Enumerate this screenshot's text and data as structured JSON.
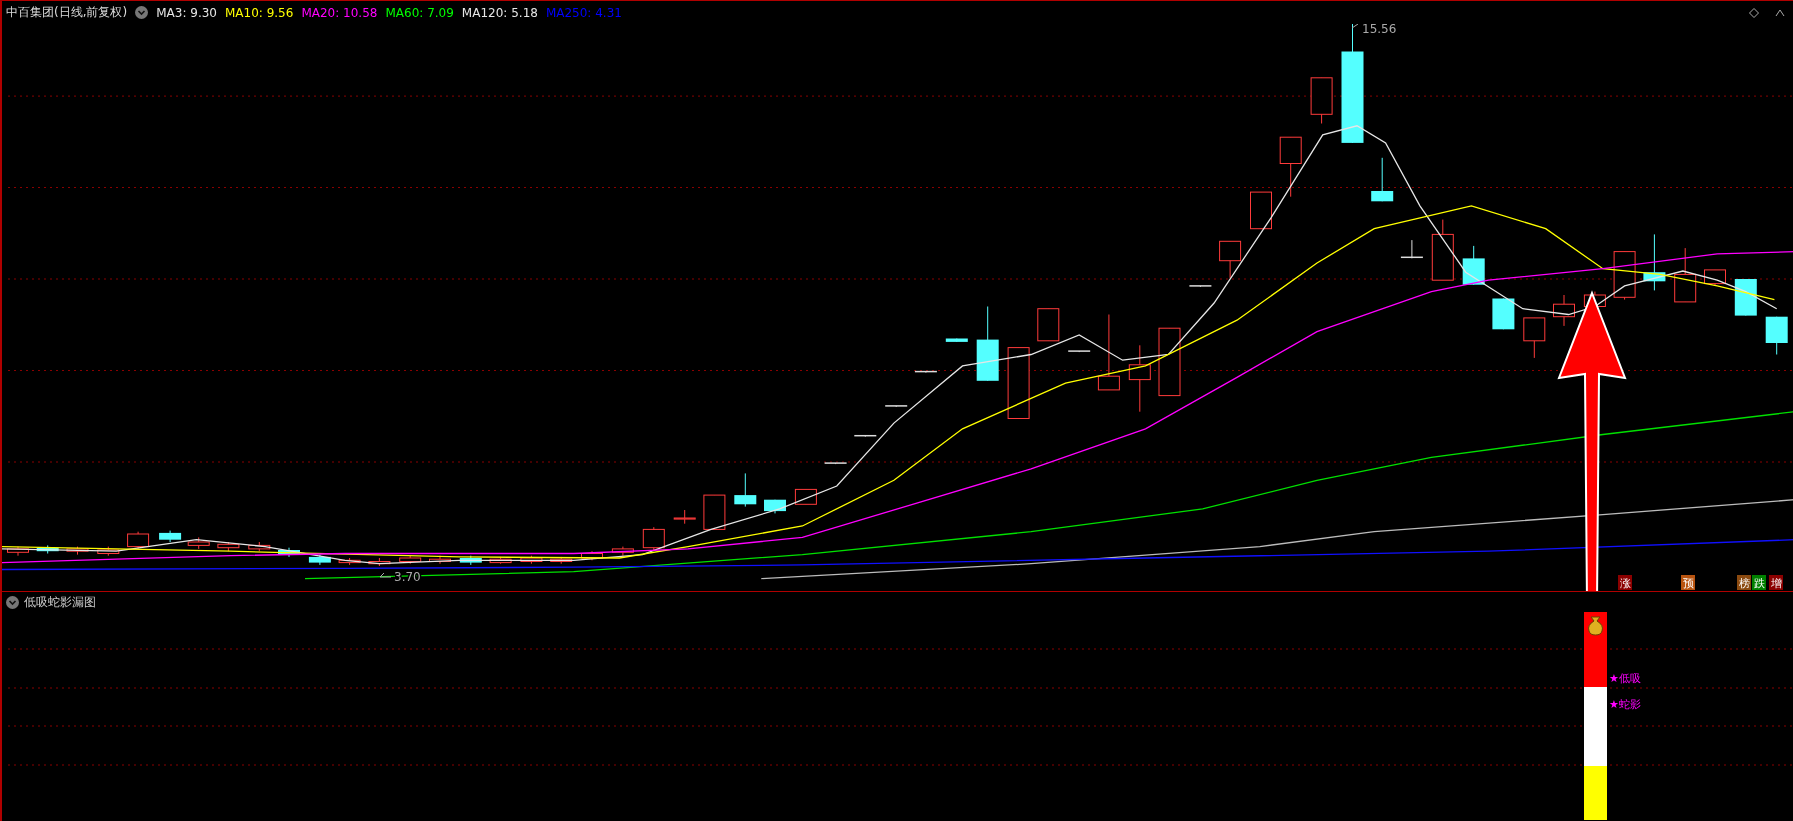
{
  "header": {
    "title": "中百集团(日线,前复权)",
    "indicators": [
      {
        "label": "MA3: 9.30",
        "color": "#e6e6e6"
      },
      {
        "label": "MA10: 9.56",
        "color": "#ffff00"
      },
      {
        "label": "MA20: 10.58",
        "color": "#ff00ff"
      },
      {
        "label": "MA60: 7.09",
        "color": "#00ff00"
      },
      {
        "label": "MA120: 5.18",
        "color": "#e6e6e6"
      },
      {
        "label": "MA250: 4.31",
        "color": "#0000ff"
      }
    ]
  },
  "main_chart": {
    "high_label": "15.56",
    "low_label": "3.70",
    "signals": [
      {
        "text": "涨",
        "color": "#8b0000"
      },
      {
        "text": "预",
        "color": "#b85410"
      },
      {
        "text": "榜",
        "color": "#8b4a10"
      },
      {
        "text": "跌",
        "color": "#008000"
      },
      {
        "text": "增",
        "color": "#8b0000"
      }
    ]
  },
  "sub_panel": {
    "title": "低吸蛇影漏图",
    "markers": [
      "★低吸",
      "★蛇影"
    ]
  }
}
